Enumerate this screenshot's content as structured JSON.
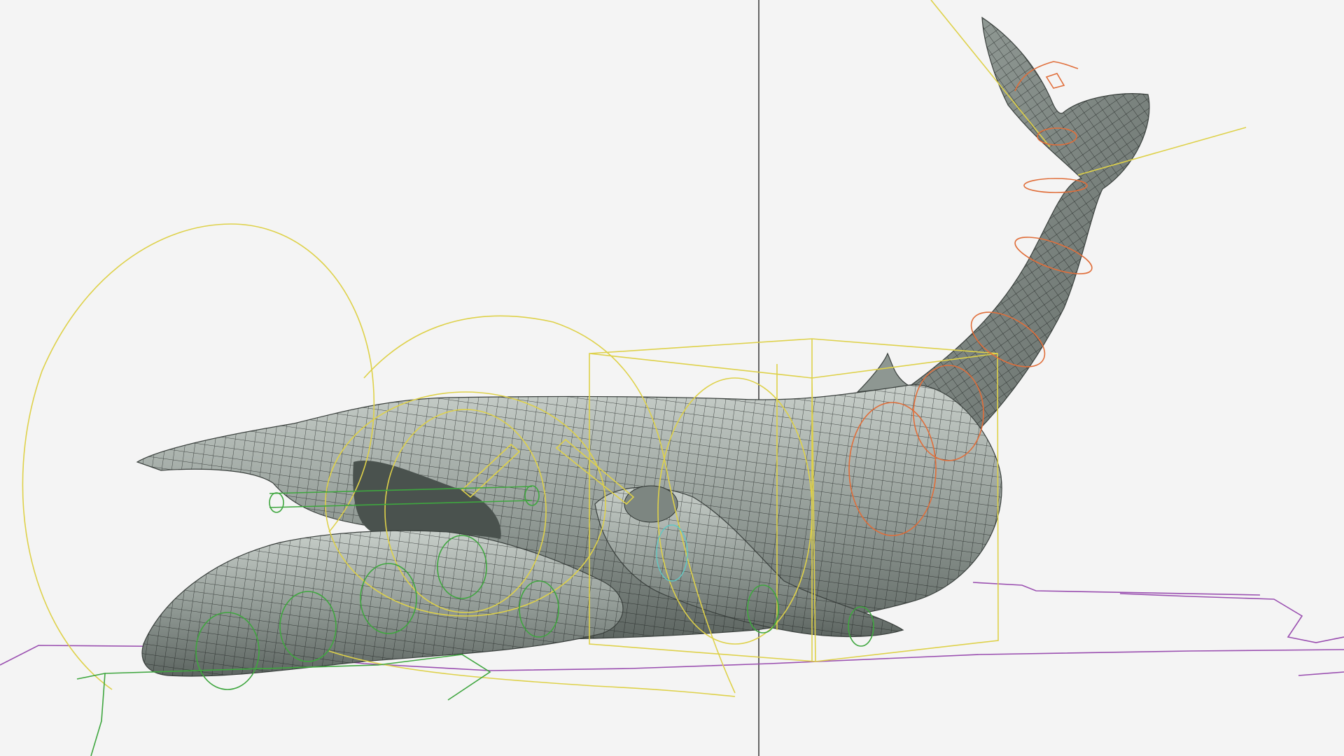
{
  "viewport": {
    "background": "#f4f4f4",
    "axis_line_color": "#2a2a2a"
  },
  "model": {
    "skin_color": "#8d9690",
    "skin_highlight": "#c9d0cb",
    "wire_color": "#1b1f1d"
  },
  "rig": {
    "controller_color_yellow": "#ded14a",
    "controller_color_green": "#3fa63f",
    "controller_color_orange": "#e06e3a",
    "controller_color_cyan": "#5fc9c4",
    "ground_curve_color": "#9a4fb0"
  }
}
